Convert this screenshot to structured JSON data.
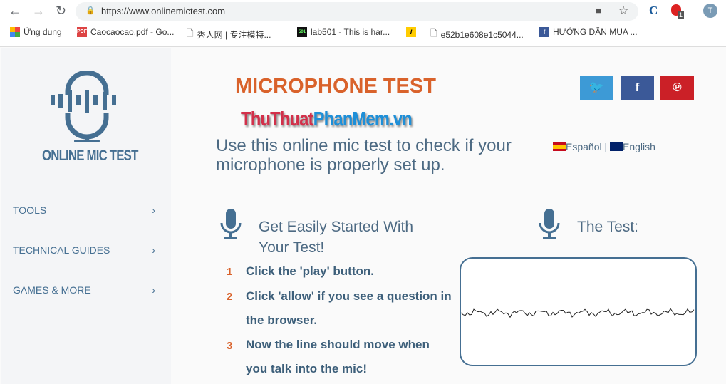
{
  "browser": {
    "url": "https://www.onlinemictest.com",
    "profile_initial": "T",
    "ext_badge": "1",
    "bookmarks": [
      {
        "label": "Ứng dụng",
        "icon": "apps-icon"
      },
      {
        "label": "Caocaocao.pdf - Go...",
        "icon": "pdf-icon"
      },
      {
        "label": "秀人网 | 专注模特...",
        "icon": "page-icon"
      },
      {
        "label": "lab501 - This is har...",
        "icon": "lab501-icon"
      },
      {
        "label": "",
        "icon": "l-icon"
      },
      {
        "label": "e52b1e608e1c5044...",
        "icon": "page-icon"
      },
      {
        "label": "HƯỚNG DẪN MUA ...",
        "icon": "facebook-icon"
      }
    ]
  },
  "sidebar": {
    "logo": "ONLINE MIC TEST",
    "items": [
      {
        "label": "TOOLS"
      },
      {
        "label": "TECHNICAL GUIDES"
      },
      {
        "label": "GAMES & MORE"
      }
    ]
  },
  "main": {
    "title": "MICROPHONE TEST",
    "watermark": "ThuThuatPhanMem.vn",
    "lead": "Use this online mic test to check if your microphone is properly set up.",
    "lang": {
      "es": "Español",
      "sep": "|",
      "en": "English"
    },
    "social": [
      {
        "name": "twitter",
        "color": "#3d9ad6"
      },
      {
        "name": "facebook",
        "color": "#3b5998"
      },
      {
        "name": "pinterest",
        "color": "#cb2027"
      }
    ],
    "started_title": "Get Easily Started With Your Test!",
    "test_title": "The Test:",
    "steps": [
      {
        "num": "1",
        "text": "Click the 'play' button."
      },
      {
        "num": "2",
        "text": "Click 'allow' if you see a question in the browser."
      },
      {
        "num": "3",
        "text": "Now the line should move when you talk into the mic!"
      }
    ]
  },
  "colors": {
    "accent": "#d9622b",
    "brand": "#456f92"
  }
}
